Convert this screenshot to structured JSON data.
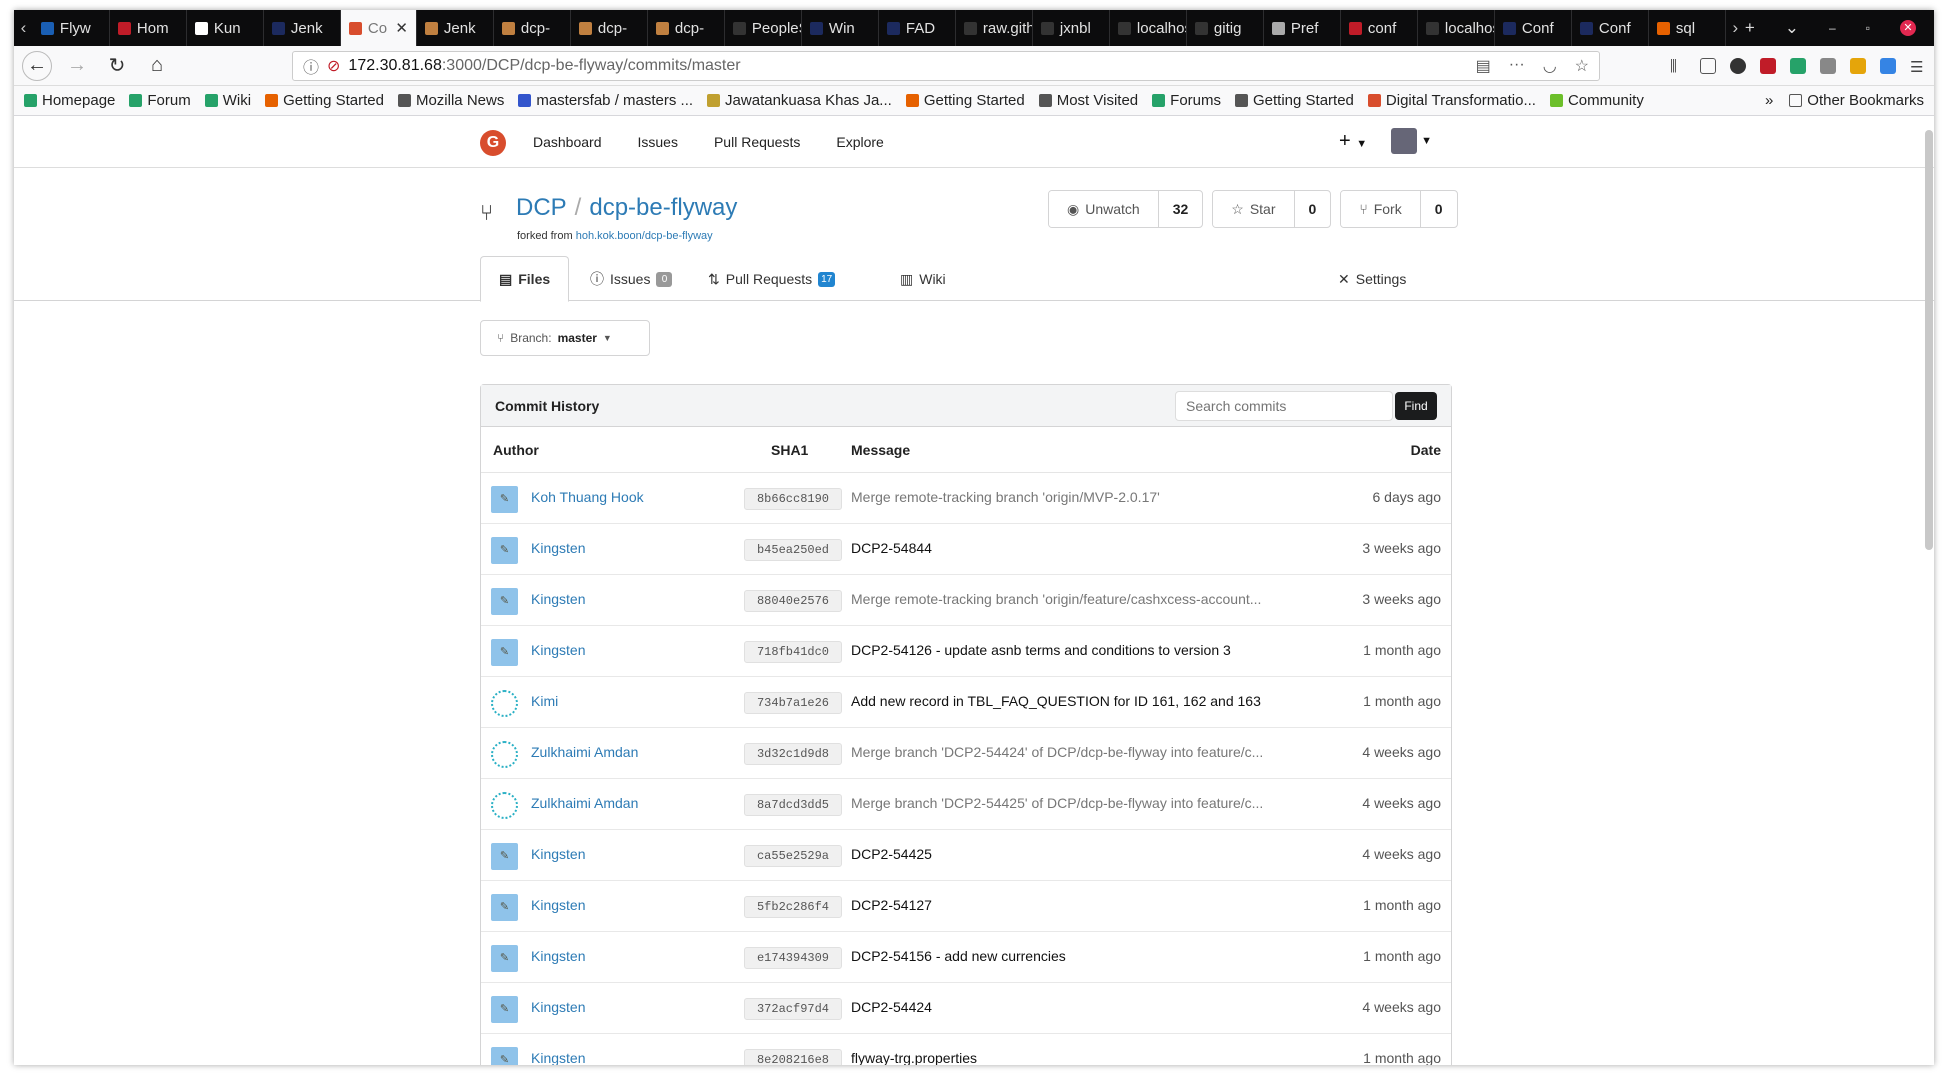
{
  "browser": {
    "tabs": [
      {
        "label": "Flyw",
        "color": "#1a5fb4"
      },
      {
        "label": "Hom",
        "color": "#c01c28"
      },
      {
        "label": "Kun",
        "color": "#ffffff"
      },
      {
        "label": "Jenk",
        "color": "#1c2a5e"
      },
      {
        "label": "Co",
        "color": "#d84d2d",
        "active": true
      },
      {
        "label": "Jenk",
        "color": "#c08040"
      },
      {
        "label": "dcp-",
        "color": "#c08040"
      },
      {
        "label": "dcp-",
        "color": "#c08040"
      },
      {
        "label": "dcp-",
        "color": "#c08040"
      },
      {
        "label": "PeopleS",
        "color": "#333333"
      },
      {
        "label": "Win",
        "color": "#1c2a5e"
      },
      {
        "label": "FAD",
        "color": "#1c2a5e"
      },
      {
        "label": "raw.gith",
        "color": "#333333"
      },
      {
        "label": "jxnbl",
        "color": "#333333"
      },
      {
        "label": "localhos",
        "color": "#333333"
      },
      {
        "label": "gitig",
        "color": "#333333"
      },
      {
        "label": "Pref",
        "color": "#aaaaaa"
      },
      {
        "label": "conf",
        "color": "#c01c28"
      },
      {
        "label": "localhos",
        "color": "#333333"
      },
      {
        "label": "Conf",
        "color": "#1c2a5e"
      },
      {
        "label": "Conf",
        "color": "#1c2a5e"
      },
      {
        "label": "sql",
        "color": "#e66100"
      }
    ],
    "url_host": "172.30.81.68",
    "url_path": ":3000/DCP/dcp-be-flyway/commits/master",
    "bookmarks": [
      {
        "label": "Homepage",
        "color": "#26a269"
      },
      {
        "label": "Forum",
        "color": "#26a269"
      },
      {
        "label": "Wiki",
        "color": "#26a269"
      },
      {
        "label": "Getting Started",
        "color": "#e66100"
      },
      {
        "label": "Mozilla News",
        "color": "#555555"
      },
      {
        "label": "mastersfab / masters ...",
        "color": "#3355cc"
      },
      {
        "label": "Jawatankuasa Khas Ja...",
        "color": "#c0a030"
      },
      {
        "label": "Getting Started",
        "color": "#e66100"
      },
      {
        "label": "Most Visited",
        "color": "#555555"
      },
      {
        "label": "Forums",
        "color": "#26a269"
      },
      {
        "label": "Getting Started",
        "color": "#555555"
      },
      {
        "label": "Digital Transformatio...",
        "color": "#d84d2d"
      },
      {
        "label": "Community",
        "color": "#6cbf2a"
      }
    ],
    "other_bookmarks": "Other Bookmarks"
  },
  "gitea": {
    "nav": [
      "Dashboard",
      "Issues",
      "Pull Requests",
      "Explore"
    ],
    "logo": "G"
  },
  "repo": {
    "owner": "DCP",
    "name": "dcp-be-flyway",
    "forked_label": "forked from",
    "forked_from": "hoh.kok.boon/dcp-be-flyway",
    "unwatch_label": "Unwatch",
    "watch_count": "32",
    "star_label": "Star",
    "star_count": "0",
    "fork_label": "Fork",
    "fork_count": "0"
  },
  "tabs": {
    "files": "Files",
    "issues": "Issues",
    "issues_count": "0",
    "pulls": "Pull Requests",
    "pulls_count": "17",
    "wiki": "Wiki",
    "settings": "Settings"
  },
  "branch": {
    "label": "Branch:",
    "name": "master"
  },
  "commits": {
    "title": "Commit History",
    "search_placeholder": "Search commits",
    "find_label": "Find",
    "col_author": "Author",
    "col_sha": "SHA1",
    "col_message": "Message",
    "col_date": "Date",
    "rows": [
      {
        "author": "Koh Thuang Hook",
        "sha": "8b66cc8190",
        "message": "Merge remote-tracking branch 'origin/MVP-2.0.17'",
        "merge": true,
        "date": "6 days ago",
        "avatar": "bot"
      },
      {
        "author": "Kingsten",
        "sha": "b45ea250ed",
        "message": "DCP2-54844",
        "merge": false,
        "date": "3 weeks ago",
        "avatar": "bot"
      },
      {
        "author": "Kingsten",
        "sha": "88040e2576",
        "message": "Merge remote-tracking branch 'origin/feature/cashxcess-account...",
        "merge": true,
        "date": "3 weeks ago",
        "avatar": "bot"
      },
      {
        "author": "Kingsten",
        "sha": "718fb41dc0",
        "message": "DCP2-54126 - update asnb terms and conditions to version 3",
        "merge": false,
        "date": "1 month ago",
        "avatar": "bot"
      },
      {
        "author": "Kimi",
        "sha": "734b7a1e26",
        "message": "Add new record in TBL_FAQ_QUESTION for ID 161, 162 and 163",
        "merge": false,
        "date": "1 month ago",
        "avatar": "pattern"
      },
      {
        "author": "Zulkhaimi Amdan",
        "sha": "3d32c1d9d8",
        "message": "Merge branch 'DCP2-54424' of DCP/dcp-be-flyway into feature/c...",
        "merge": true,
        "date": "4 weeks ago",
        "avatar": "pattern"
      },
      {
        "author": "Zulkhaimi Amdan",
        "sha": "8a7dcd3dd5",
        "message": "Merge branch 'DCP2-54425' of DCP/dcp-be-flyway into feature/c...",
        "merge": true,
        "date": "4 weeks ago",
        "avatar": "pattern"
      },
      {
        "author": "Kingsten",
        "sha": "ca55e2529a",
        "message": "DCP2-54425",
        "merge": false,
        "date": "4 weeks ago",
        "avatar": "bot"
      },
      {
        "author": "Kingsten",
        "sha": "5fb2c286f4",
        "message": "DCP2-54127",
        "merge": false,
        "date": "1 month ago",
        "avatar": "bot"
      },
      {
        "author": "Kingsten",
        "sha": "e174394309",
        "message": "DCP2-54156 - add new currencies",
        "merge": false,
        "date": "1 month ago",
        "avatar": "bot"
      },
      {
        "author": "Kingsten",
        "sha": "372acf97d4",
        "message": "DCP2-54424",
        "merge": false,
        "date": "4 weeks ago",
        "avatar": "bot"
      },
      {
        "author": "Kingsten",
        "sha": "8e208216e8",
        "message": "flyway-trg.properties",
        "merge": false,
        "date": "1 month ago",
        "avatar": "bot"
      }
    ]
  },
  "colors": {
    "link": "#2d7bb5",
    "badge_issues": "#999999",
    "badge_pulls": "#2185d0",
    "avatar_bot": "#8fc3ea",
    "avatar_pattern": "#2ab0c5"
  }
}
